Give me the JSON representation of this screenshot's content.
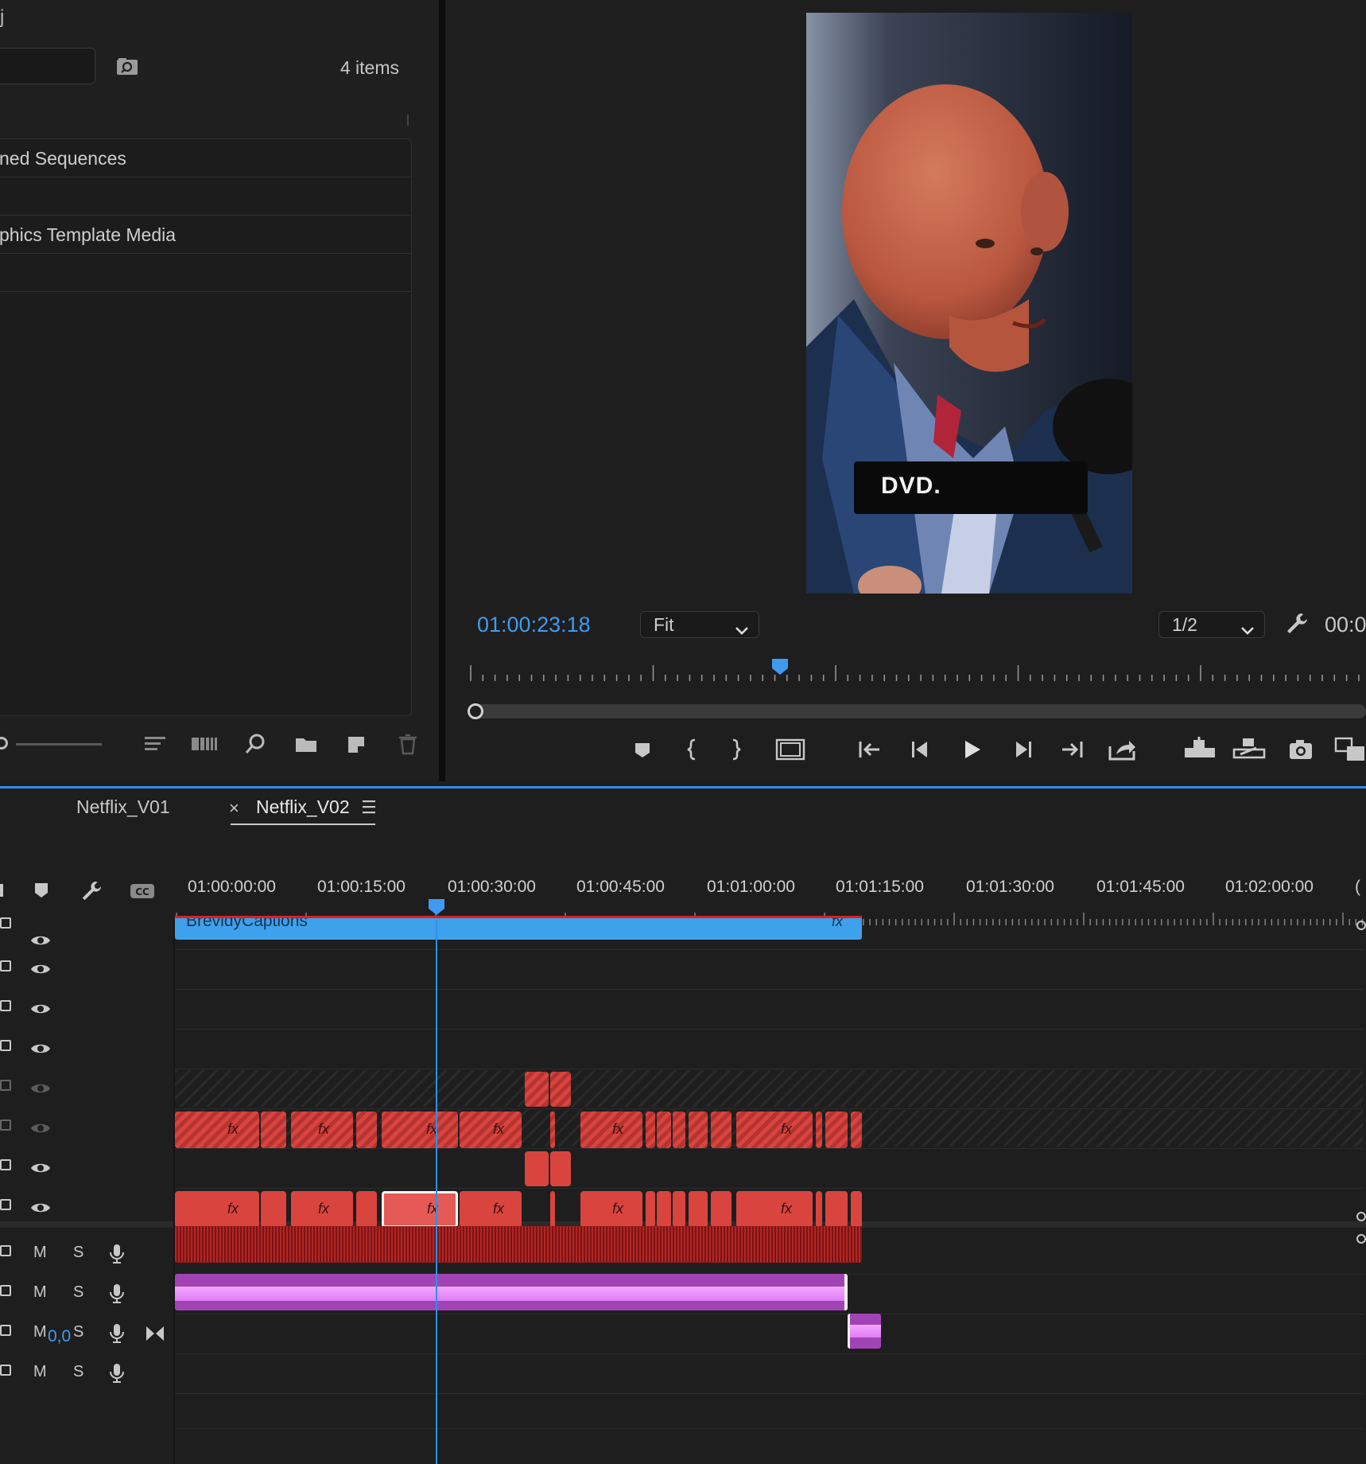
{
  "project": {
    "title_fragment": "j",
    "items_count": "4 items",
    "bins": [
      {
        "label": "ned Sequences"
      },
      {
        "label": ""
      },
      {
        "label": "phics Template Media"
      },
      {
        "label": ""
      }
    ],
    "bottom_icons": [
      "zoom-slider",
      "list-view-icon",
      "icon-view-icon",
      "find-icon",
      "new-bin-icon",
      "new-item-icon",
      "trash-icon"
    ]
  },
  "monitor": {
    "caption_text": "DVD.",
    "current_timecode": "01:00:23:18",
    "zoom": "Fit",
    "resolution": "1/2",
    "duration_timecode": "00:0",
    "playhead_position": 0.347,
    "transport_icons": [
      "add-marker-icon",
      "mark-in-icon",
      "mark-out-icon",
      "safe-margins-icon",
      "go-to-in-icon",
      "step-back-icon",
      "play-icon",
      "step-forward-icon",
      "go-to-out-icon",
      "export-frame-icon",
      "lift-icon",
      "extract-icon",
      "camera-icon",
      "compare-icon"
    ]
  },
  "timeline": {
    "tabs": [
      {
        "label": "Netflix_V01",
        "active": false
      },
      {
        "label": "Netflix_V02",
        "active": true
      }
    ],
    "tab_close": "×",
    "time_labels": [
      "01:00:00:00",
      "01:00:15:00",
      "01:00:30:00",
      "01:00:45:00",
      "01:01:00:00",
      "01:01:15:00",
      "01:01:30:00",
      "01:01:45:00",
      "01:02:00:00",
      "("
    ],
    "captions_clip_label": "BrevidyCaptions",
    "fx_label": "fx",
    "audio_track_buttons": {
      "mute": "M",
      "solo": "S"
    },
    "master_level": "0,0",
    "colors": {
      "accent": "#2f8fe8",
      "video_clip": "#d9443f",
      "caption_clip": "#3ea1ec",
      "music_clip": "#a243b5",
      "timecode": "#3f9bf0"
    }
  }
}
